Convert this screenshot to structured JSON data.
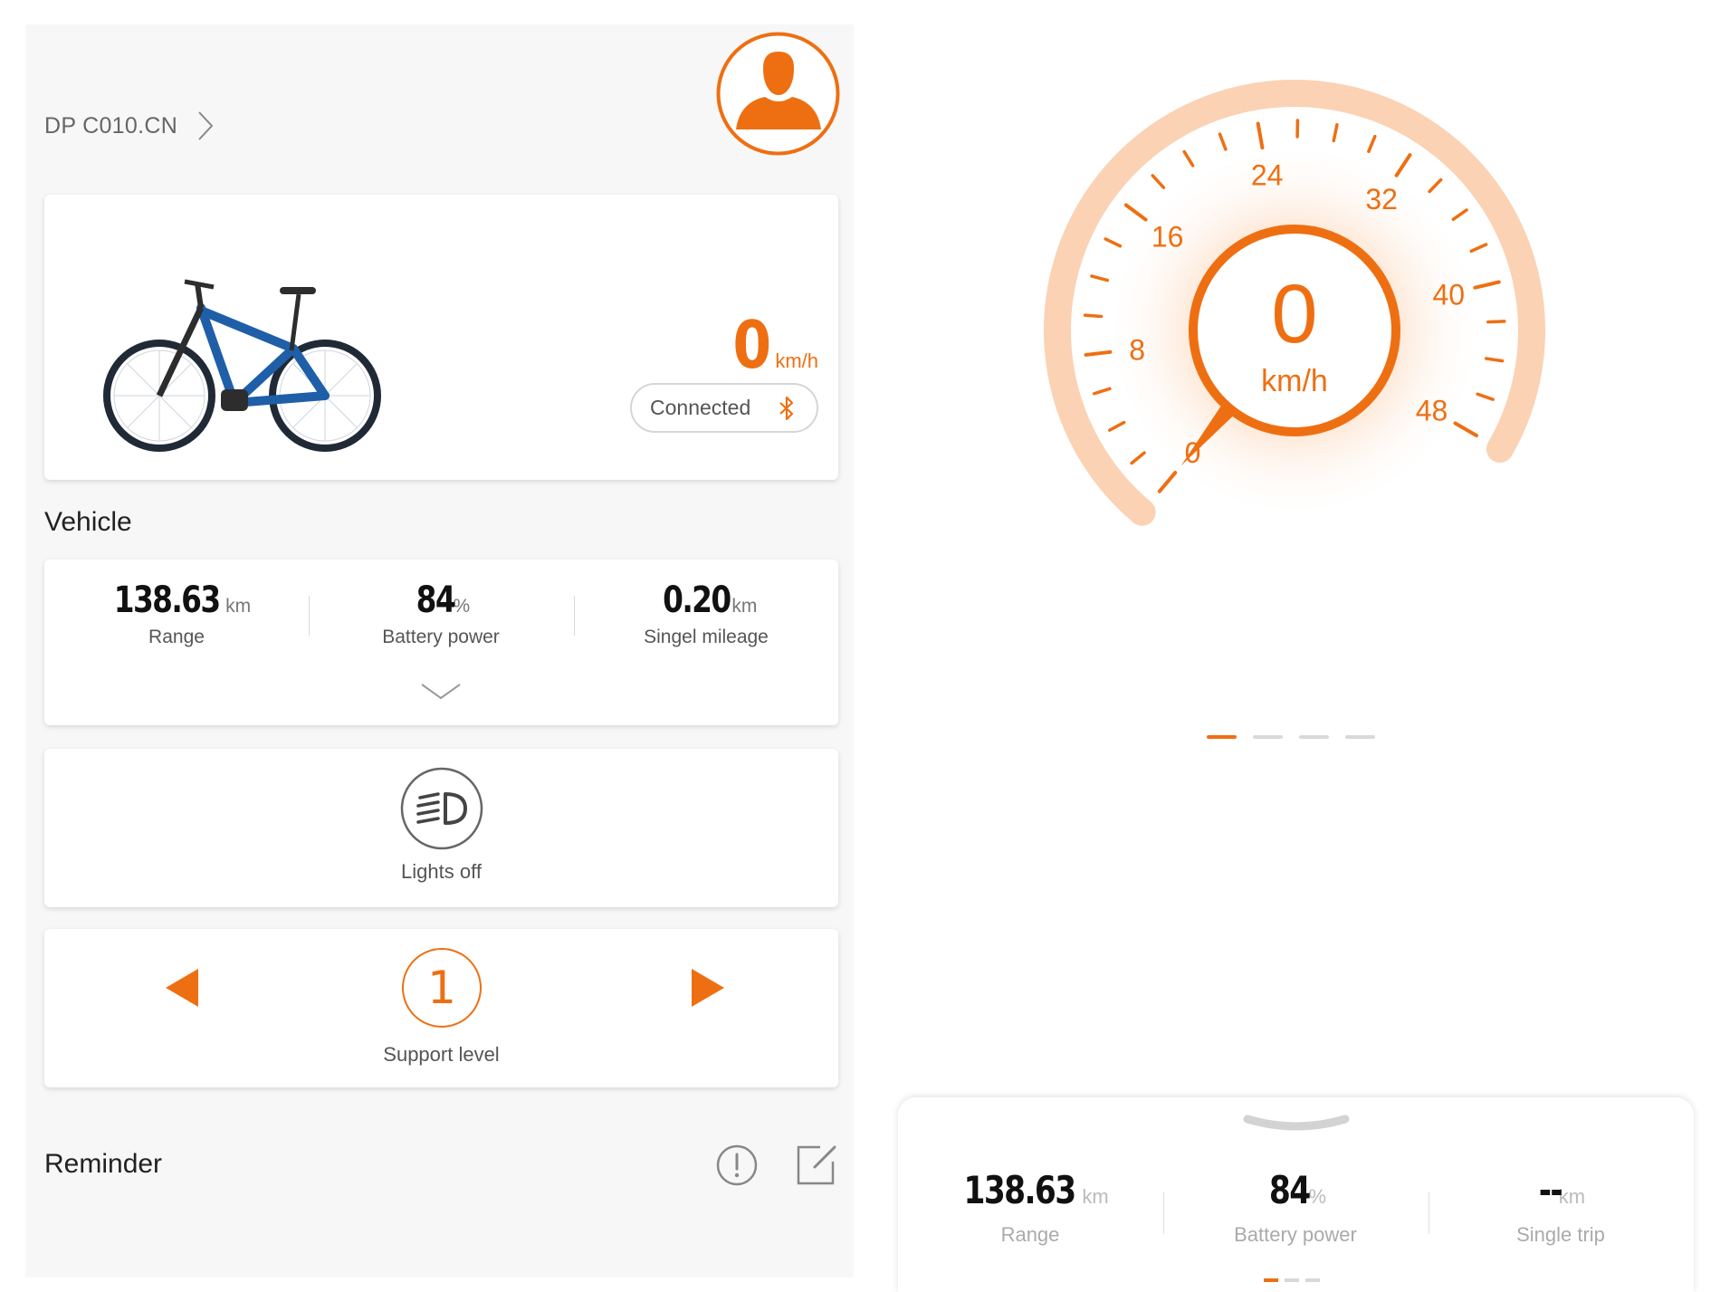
{
  "header": {
    "device_name": "DP C010.CN"
  },
  "bike_card": {
    "speed_value": "0",
    "speed_unit": "km/h",
    "connection_status": "Connected"
  },
  "vehicle": {
    "section_title": "Vehicle",
    "stats": [
      {
        "value": "138.63",
        "unit": "km",
        "label": "Range"
      },
      {
        "value": "84",
        "unit": "%",
        "label": "Battery power"
      },
      {
        "value": "0.20",
        "unit": "km",
        "label": "Singel mileage"
      }
    ]
  },
  "lights": {
    "label": "Lights off"
  },
  "support": {
    "level": "1",
    "label": "Support level"
  },
  "reminder": {
    "title": "Reminder"
  },
  "speedometer": {
    "speed_value": "0",
    "speed_unit": "km/h",
    "ticks": [
      "0",
      "8",
      "16",
      "24",
      "32",
      "40",
      "48"
    ],
    "min": 0,
    "max": 48,
    "current": 0
  },
  "pager": {
    "count": 4,
    "active_index": 0
  },
  "bottom_sheet": {
    "stats": [
      {
        "value": "138.63",
        "unit": "km",
        "label": "Range"
      },
      {
        "value": "84",
        "unit": "%",
        "label": "Battery power"
      },
      {
        "value": "--",
        "unit": "km",
        "label": "Single trip"
      }
    ]
  },
  "colors": {
    "accent": "#ee6f12",
    "gauge_ring": "#fbd2b4",
    "card_bg": "#ffffff",
    "screen_bg": "#f7f7f7"
  },
  "icons": {
    "avatar": "user-avatar-icon",
    "chevron": "chevron-right-icon",
    "bluetooth": "bluetooth-icon",
    "headlight": "headlight-icon",
    "alert": "alert-circle-icon",
    "edit": "edit-icon"
  }
}
